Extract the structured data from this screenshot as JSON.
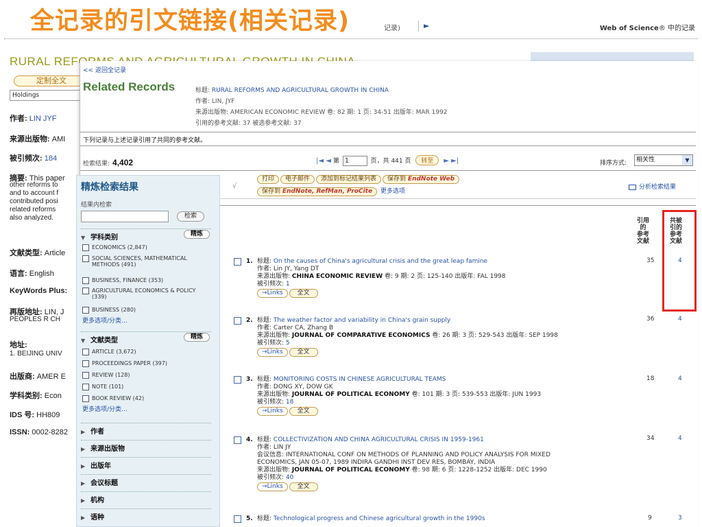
{
  "banner": "全记录的引文链接(相关记录)",
  "topstrip": {
    "left_text": "记录)",
    "arrow": "►",
    "wos_prefix": "Web of Science",
    "wos_suffix": "® 中的记录"
  },
  "background_record": {
    "title": "RURAL REFORMS AND AGRICULTURAL GROWTH IN CHINA",
    "custom_fulltext_button": "定制全文",
    "holdings": "Holdings",
    "author_label": "作者:",
    "author_value": "LIN JYF",
    "source_label": "来源出版物:",
    "source_value": "AMI",
    "cited_label": "被引频次:",
    "cited_value": "184",
    "abstract_label": "摘要:",
    "abstract_value": "This paper",
    "abstract_lines": [
      "other reforms to",
      "and to account f",
      "contributed posi",
      "related reforms",
      "also analyzed."
    ],
    "doctype_label": "文献类型:",
    "doctype_value": "Article",
    "lang_label": "语言:",
    "lang_value": "English",
    "keywords_label": "KeyWords Plus:",
    "reprint_label": "再版地址:",
    "reprint_value": "LIN, J",
    "reprint_line2": "PEOPLES R CH",
    "address_label": "地址:",
    "address_line": "1. BEIJING UNIV",
    "publisher_label": "出版商:",
    "publisher_value": "AMER E",
    "subject_label": "学科类别:",
    "subject_value": "Econ",
    "ids_label": "IDS 号:",
    "ids_value": "HH809",
    "issn_label": "ISSN:",
    "issn_value": "0002-8282"
  },
  "main": {
    "back_link": "<< 返回全记录",
    "title": "Related Records",
    "source_lines": [
      {
        "label": "标题:",
        "value": "RURAL REFORMS AND AGRICULTURAL GROWTH IN CHINA",
        "link": true
      },
      {
        "label": "作者:",
        "value": "LIN, JYF",
        "link": false
      },
      {
        "label": "来源出版物:",
        "value": "AMERICAN ECONOMIC REVIEW 卷: 82 期: 1 页: 34-51 出版年: MAR 1992",
        "link": false
      },
      {
        "label": "引用的参考文献:",
        "value": "37 被选参考文献: 37",
        "link": false
      }
    ],
    "note": "下列记录与上述记录引用了共同的参考文献。",
    "results_label": "检索结果:",
    "results_count": "4,402",
    "pager": {
      "first_prev": "|◄ ◄",
      "page_label": "第",
      "page_value": "1",
      "of_label": "页，共 441 页",
      "go_button": "转至",
      "next_last": "► ►|"
    },
    "sort_label": "排序方式:",
    "sort_value": "相关性",
    "toolbar_row1": [
      "打印",
      "电子邮件",
      "添加到标记结果列表",
      "保存到 "
    ],
    "endnote_web": "EndNote Web",
    "toolbar_row2_save": "保存到 ",
    "toolbar_row2_formats": "EndNote, RefMan, ProCite",
    "more_options": "更多选项",
    "analyze": "分析检索结果",
    "col_headers": {
      "cited_refs": "引用\n的\n参考\n文献",
      "shared_refs": "共被\n引的\n参考\n文献"
    },
    "records": [
      {
        "num": "1.",
        "title_label": "标题:",
        "title": "On the causes of China's agricultural crisis and the great leap famine",
        "author_label": "作者:",
        "authors": "Lin JY, Yang DT",
        "conf": "",
        "source_label": "来源出版物:",
        "source_bold": "CHINA ECONOMIC REVIEW",
        "source_detail": " 卷: 9  期: 2  页: 125-140  出版年: FAL 1998",
        "cited_label": "被引频次:",
        "cited": "1",
        "links": "→Links",
        "fulltext": "全文",
        "refs": "35",
        "shared": "4"
      },
      {
        "num": "2.",
        "title_label": "标题:",
        "title": "The weather factor and variability in China's grain supply",
        "author_label": "作者:",
        "authors": "Carter CA, Zhang B",
        "conf": "",
        "source_label": "来源出版物:",
        "source_bold": "JOURNAL OF COMPARATIVE ECONOMICS",
        "source_detail": " 卷: 26  期: 3  页: 529-543  出版年: SEP 1998",
        "cited_label": "被引频次:",
        "cited": "5",
        "links": "→Links",
        "fulltext": "全文",
        "refs": "36",
        "shared": "4"
      },
      {
        "num": "3.",
        "title_label": "标题:",
        "title": "MONITORING COSTS IN CHINESE AGRICULTURAL TEAMS",
        "author_label": "作者:",
        "authors": "DONG XY, DOW GK",
        "conf": "",
        "source_label": "来源出版物:",
        "source_bold": "JOURNAL OF POLITICAL ECONOMY",
        "source_detail": " 卷: 101  期: 3  页: 539-553  出版年: JUN 1993",
        "cited_label": "被引频次:",
        "cited": "18",
        "links": "→Links",
        "fulltext": "全文",
        "refs": "18",
        "shared": "4"
      },
      {
        "num": "4.",
        "title_label": "标题:",
        "title": "COLLECTIVIZATION AND CHINA AGRICULTURAL CRISIS IN 1959-1961",
        "author_label": "作者:",
        "authors": "LIN JY",
        "conf_label": "会议信息:",
        "conf": "INTERNATIONAL CONF ON METHODS OF PLANNING AND POLICY ANALYSIS FOR MIXED",
        "conf2": "ECONOMICS, JAN 05-07, 1989 INDIRA GANDHI INST DEV RES, BOMBAY, INDIA",
        "source_label": "来源出版物:",
        "source_bold": "JOURNAL OF POLITICAL ECONOMY",
        "source_detail": " 卷: 98  期: 6  页: 1228-1252  出版年: DEC 1990",
        "cited_label": "被引频次:",
        "cited": "40",
        "links": "→Links",
        "fulltext": "全文",
        "refs": "34",
        "shared": "4"
      },
      {
        "num": "5.",
        "title_label": "标题:",
        "title": "Technological progress and Chinese agricultural growth in the 1990s",
        "refs": "9",
        "shared": "3"
      }
    ]
  },
  "refine": {
    "title": "精炼检索结果",
    "sub": "结果内检索",
    "search_button": "检索",
    "refine_button": "精炼",
    "subject_header": "学科类别",
    "subject_items": [
      "ECONOMICS (2,847)",
      "SOCIAL SCIENCES, MATHEMATICAL METHODS (491)",
      "BUSINESS, FINANCE (353)",
      "AGRICULTURAL ECONOMICS & POLICY (339)",
      "BUSINESS (280)"
    ],
    "more1": "更多选项/分类…",
    "doctype_header": "文献类型",
    "doctype_items": [
      "ARTICLE (3,672)",
      "PROCEEDINGS PAPER (397)",
      "REVIEW (128)",
      "NOTE (101)",
      "BOOK REVIEW (42)"
    ],
    "more2": "更多选项/分类…",
    "collapsed": [
      "作者",
      "来源出版物",
      "出版年",
      "会议标题",
      "机构",
      "语种"
    ]
  }
}
